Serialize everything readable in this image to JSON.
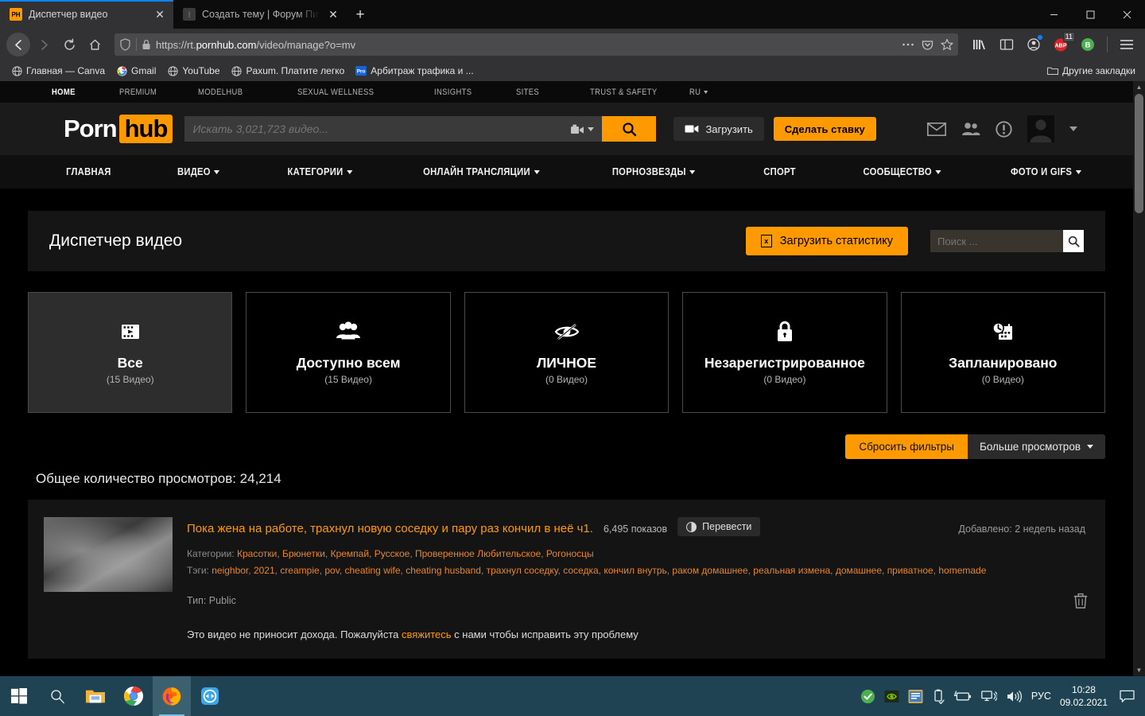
{
  "browser": {
    "tabs": [
      {
        "title": "Диспетчер видео",
        "favicon": "ph-icon",
        "active": true
      },
      {
        "title": "Создать тему | Форум Пиратск",
        "favicon": "forum-icon",
        "active": false
      }
    ],
    "new_tab_label": "+",
    "window_controls": {
      "minimize": "–",
      "maximize": "❐",
      "close": "✕"
    },
    "url": {
      "prefix": "https://rt.",
      "domain": "pornhub.com",
      "suffix": "/video/manage?o=mv"
    },
    "toolbar_icons": [
      "library-icon",
      "sidebar-icon",
      "account-icon",
      "adblock-icon",
      "bitwarden-icon",
      "hamburger-menu-icon"
    ],
    "adblock_badge": "11",
    "bitwarden_label": "B",
    "bookmarks": [
      {
        "label": "Главная — Canva",
        "icon": "globe-icon"
      },
      {
        "label": "Gmail",
        "icon": "google-icon"
      },
      {
        "label": "YouTube",
        "icon": "globe-icon"
      },
      {
        "label": "Paxum. Платите легко",
        "icon": "globe-icon"
      },
      {
        "label": "Арбитраж трафика и ...",
        "icon": "pro-icon"
      }
    ],
    "other_bookmarks": {
      "label": "Другие закладки",
      "icon": "folder-icon"
    }
  },
  "site": {
    "topbar": [
      {
        "label": "HOME",
        "active": true
      },
      {
        "label": "PREMIUM",
        "active": false
      },
      {
        "label": "MODELHUB",
        "active": false
      },
      {
        "label": "SEXUAL WELLNESS",
        "active": false
      },
      {
        "label": "INSIGHTS",
        "active": false
      },
      {
        "label": "SITES",
        "active": false
      },
      {
        "label": "TRUST & SAFETY",
        "active": false
      },
      {
        "label": "RU",
        "active": false,
        "caret": true
      }
    ],
    "logo": {
      "part1": "Porn",
      "part2": "hub"
    },
    "search": {
      "placeholder": "Искать 3,021,723 видео...",
      "value": ""
    },
    "upload_label": "Загрузить",
    "bid_label": "Сделать ставку",
    "user_icons": [
      "mail-icon",
      "friends-icon",
      "alert-icon",
      "avatar",
      "chevron-down-icon"
    ],
    "nav": [
      {
        "label": "ГЛАВНАЯ",
        "caret": false
      },
      {
        "label": "ВИДЕО",
        "caret": true
      },
      {
        "label": "КАТЕГОРИИ",
        "caret": true
      },
      {
        "label": "ОНЛАЙН ТРАНСЛЯЦИИ",
        "caret": true
      },
      {
        "label": "ПОРНОЗВЕЗДЫ",
        "caret": true
      },
      {
        "label": "СПОРТ",
        "caret": false
      },
      {
        "label": "СООБЩЕСТВО",
        "caret": true
      },
      {
        "label": "ФОТО И GIFS",
        "caret": true
      }
    ]
  },
  "manager": {
    "title": "Диспетчер видео",
    "download_stats_label": "Загрузить статистику",
    "download_stats_icon": "xls-icon",
    "search_placeholder": "Поиск ...",
    "search_value": "",
    "search_icon": "search-icon",
    "cards": [
      {
        "label": "Все",
        "count": "(15 Видео)",
        "icon": "film-icon",
        "selected": true
      },
      {
        "label": "Доступно всем",
        "count": "(15 Видео)",
        "icon": "people-icon",
        "selected": false
      },
      {
        "label": "ЛИЧНОЕ",
        "count": "(0 Видео)",
        "icon": "eye-off-icon",
        "selected": false
      },
      {
        "label": "Незарегистрированное",
        "count": "(0 Видео)",
        "icon": "lock-icon",
        "selected": false
      },
      {
        "label": "Запланировано",
        "count": "(0 Видео)",
        "icon": "calendar-clock-icon",
        "selected": false
      }
    ],
    "reset_filters_label": "Сбросить фильтры",
    "sort_label": "Больше просмотров",
    "total_views_label": "Общее количество просмотров: 24,214"
  },
  "video": {
    "title": "Пока жена на работе, трахнул новую соседку и пару раз кончил в неё ч1.",
    "views": "6,495 показов",
    "translate_label": "Перевести",
    "added_label": "Добавлено: 2 недель назад",
    "categories_label": "Категории:",
    "categories": [
      "Красотки",
      "Брюнетки",
      "Кремпай",
      "Русское",
      "Проверенное Любительское",
      "Рогоносцы"
    ],
    "tags_label": "Тэги:",
    "tags": [
      "neighbor",
      "2021",
      "creampie",
      "pov",
      "cheating wife",
      "cheating husband",
      "трахнул соседку",
      "соседка",
      "кончил внутрь",
      "раком домашнее",
      "реальная измена",
      "домашнее",
      "приватное",
      "homemade"
    ],
    "type_label": "Тип:",
    "type_value": "Public",
    "notice_before": "Это видео не приносит дохода. Пожалуйста ",
    "notice_link": "свяжитесь",
    "notice_after": " с нами чтобы исправить эту проблему",
    "delete_icon": "trash-icon"
  },
  "taskbar": {
    "start_icon": "windows-icon",
    "search_icon": "search-icon",
    "pinned": [
      "file-explorer-icon",
      "chrome-icon",
      "firefox-icon",
      "teamviewer-icon"
    ],
    "tray": [
      "shield-check-icon",
      "nvidia-icon",
      "app-icon",
      "usb-icon",
      "battery-icon",
      "network-icon",
      "volume-icon"
    ],
    "language": "РУС",
    "time": "10:28",
    "date": "09.02.2021",
    "notification_icon": "notification-icon"
  },
  "colors": {
    "accent": "#ff9000",
    "page_bg": "#000000",
    "panel_bg": "#141414",
    "browser_chrome": "#323234",
    "taskbar": "#1f4352"
  }
}
